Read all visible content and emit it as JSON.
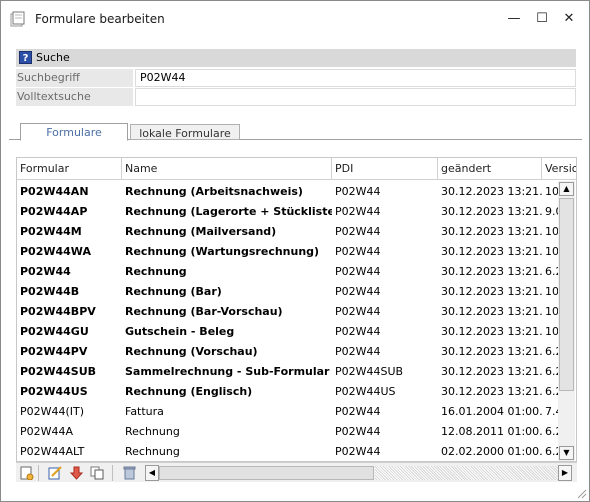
{
  "window": {
    "title": "Formulare bearbeiten",
    "min_glyph": "—",
    "max_glyph": "☐",
    "close_glyph": "✕"
  },
  "search": {
    "title": "Suche",
    "help_glyph": "?",
    "fields": [
      {
        "label": "Suchbegriff",
        "value": "P02W44"
      },
      {
        "label": "Volltextsuche",
        "value": ""
      }
    ]
  },
  "tabs": [
    {
      "label": "Formulare",
      "active": true
    },
    {
      "label": "lokale Formulare",
      "active": false
    }
  ],
  "table": {
    "columns": [
      "Formular",
      "Name",
      "PDI",
      "geändert",
      "Version"
    ],
    "rows": [
      {
        "bold": true,
        "cells": [
          "P02W44AN",
          "Rechnung (Arbeitsnachweis)",
          "P02W44",
          "30.12.2023 13:21…",
          "10"
        ]
      },
      {
        "bold": true,
        "cells": [
          "P02W44AP",
          "Rechnung (Lagerorte + Stückliste)",
          "P02W44",
          "30.12.2023 13:21…",
          "9.0"
        ]
      },
      {
        "bold": true,
        "cells": [
          "P02W44M",
          "Rechnung (Mailversand)",
          "P02W44",
          "30.12.2023 13:21…",
          "10"
        ]
      },
      {
        "bold": true,
        "cells": [
          "P02W44WA",
          "Rechnung (Wartungsrechnung)",
          "P02W44",
          "30.12.2023 13:21…",
          "10"
        ]
      },
      {
        "bold": true,
        "cells": [
          "P02W44",
          "Rechnung",
          "P02W44",
          "30.12.2023 13:21…",
          "6.2"
        ]
      },
      {
        "bold": true,
        "cells": [
          "P02W44B",
          "Rechnung (Bar)",
          "P02W44",
          "30.12.2023 13:21…",
          "10"
        ]
      },
      {
        "bold": true,
        "cells": [
          "P02W44BPV",
          "Rechnung (Bar-Vorschau)",
          "P02W44",
          "30.12.2023 13:21…",
          "10"
        ]
      },
      {
        "bold": true,
        "cells": [
          "P02W44GU",
          "Gutschein - Beleg",
          "P02W44",
          "30.12.2023 13:21…",
          "10"
        ]
      },
      {
        "bold": true,
        "cells": [
          "P02W44PV",
          "Rechnung (Vorschau)",
          "P02W44",
          "30.12.2023 13:21…",
          "6.2"
        ]
      },
      {
        "bold": true,
        "cells": [
          "P02W44SUB",
          "Sammelrechnung - Sub-Formular",
          "P02W44SUB",
          "30.12.2023 13:21…",
          "6.2"
        ]
      },
      {
        "bold": true,
        "cells": [
          "P02W44US",
          "Rechnung (Englisch)",
          "P02W44US",
          "30.12.2023 13:21…",
          "6.2"
        ]
      },
      {
        "bold": false,
        "cells": [
          "P02W44(IT)",
          "Fattura",
          "P02W44",
          "16.01.2004 01:00…",
          "7.4"
        ]
      },
      {
        "bold": false,
        "cells": [
          "P02W44A",
          "Rechnung",
          "P02W44",
          "12.08.2011 01:00…",
          "6.2"
        ]
      },
      {
        "bold": false,
        "cells": [
          "P02W44ALT",
          "Rechnung",
          "P02W44",
          "02.02.2000 01:00…",
          "6.2"
        ]
      }
    ]
  },
  "scroll": {
    "up": "▲",
    "down": "▼",
    "left": "◀",
    "right": "▶"
  },
  "icons": {
    "new": "new-form-icon",
    "edit": "edit-form-icon",
    "import": "import-arrow-icon",
    "copy": "copy-icon",
    "delete": "trash-icon"
  },
  "colors": {
    "accent_tab": "#4a6fa5",
    "header_bg": "#d9d9d9",
    "label_bg": "#e8e8e8"
  }
}
